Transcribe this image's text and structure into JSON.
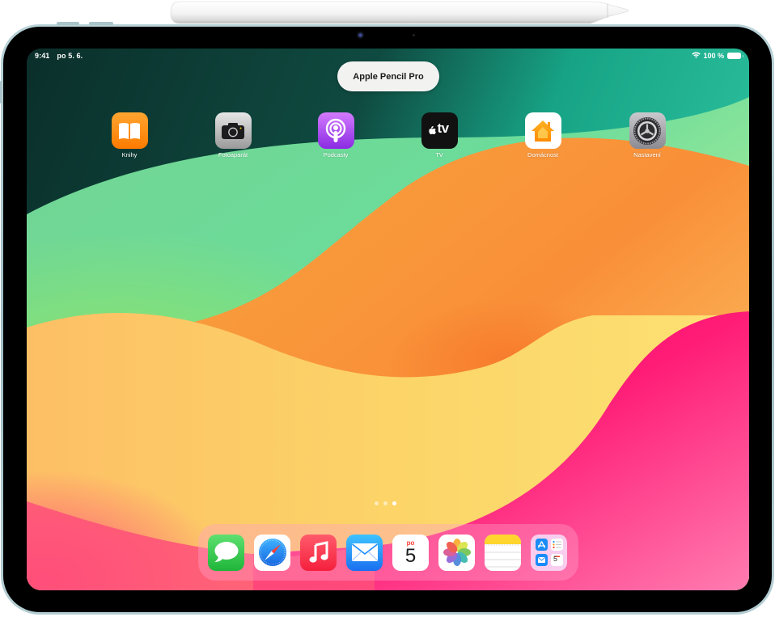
{
  "device": {
    "accessory": "Apple Pencil Pro"
  },
  "status_bar": {
    "time": "9:41",
    "date": "po 5. 6.",
    "wifi_icon": "wifi-icon",
    "battery_percent": "100 %",
    "battery_icon": "battery-full-icon",
    "battery_level": 1.0
  },
  "pencil_notification": {
    "label": "Apple Pencil Pro"
  },
  "home_screen": {
    "apps": [
      {
        "label": "Knihy",
        "icon": "books-icon",
        "color": "#ff9500"
      },
      {
        "label": "Fotoaparát",
        "icon": "camera-icon",
        "color": "#8e8e93"
      },
      {
        "label": "Podcasty",
        "icon": "podcasts-icon",
        "color": "#a855f7"
      },
      {
        "label": "TV",
        "icon": "apple-tv-icon",
        "color": "#111111",
        "glyph_text": "tv"
      },
      {
        "label": "Domácnost",
        "icon": "home-icon",
        "color": "#ffffff"
      },
      {
        "label": "Nastavení",
        "icon": "settings-gear-icon",
        "color": "#8e8e93"
      }
    ],
    "page_dots": {
      "count": 3,
      "active_index": 2
    }
  },
  "dock": {
    "apps": [
      {
        "name": "Zprávy",
        "icon": "messages-icon",
        "color": "#34c759"
      },
      {
        "name": "Safari",
        "icon": "safari-compass-icon",
        "color": "#1e90ff"
      },
      {
        "name": "Hudba",
        "icon": "music-note-icon",
        "color": "#fa2d48"
      },
      {
        "name": "Mail",
        "icon": "mail-envelope-icon",
        "color": "#1a8cff"
      },
      {
        "name": "Kalendář",
        "icon": "calendar-icon",
        "color": "#ffffff",
        "weekday": "po",
        "day": "5"
      },
      {
        "name": "Fotky",
        "icon": "photos-flower-icon",
        "color": "#ffffff"
      },
      {
        "name": "Poznámky",
        "icon": "notes-icon",
        "color": "#ffffff"
      },
      {
        "name": "Nedávné aplikace",
        "icon": "app-library-folder-icon",
        "color": "#f7c8ea",
        "mini_calendar_day": "5"
      }
    ]
  }
}
